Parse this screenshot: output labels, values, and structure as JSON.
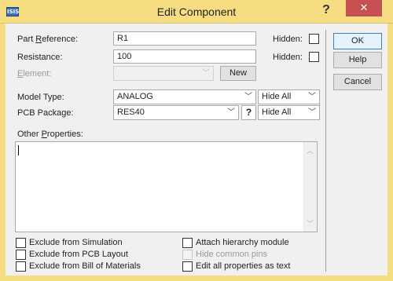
{
  "window": {
    "title": "Edit Component",
    "app_icon_text": "ISIS",
    "help_glyph": "?",
    "close_glyph": "✕"
  },
  "fields": {
    "part_reference": {
      "label_prefix": "Part ",
      "label_underline": "R",
      "label_suffix": "eference:",
      "value": "R1",
      "hidden_label": "Hidden:"
    },
    "resistance": {
      "label": "Resistance:",
      "value": "100",
      "hidden_label": "Hidden:"
    },
    "element": {
      "label_underline": "E",
      "label_suffix": "lement:",
      "value": "",
      "button": "New"
    },
    "model_type": {
      "label": "Model Type:",
      "value": "ANALOG",
      "hide_value": "Hide All"
    },
    "pcb_package": {
      "label": "PCB Package:",
      "value": "RES40",
      "query_button": "?",
      "hide_value": "Hide All"
    },
    "other_properties": {
      "label_prefix": "Other ",
      "label_underline": "P",
      "label_suffix": "roperties:",
      "value": ""
    }
  },
  "buttons": {
    "ok": "OK",
    "help": "Help",
    "cancel": "Cancel"
  },
  "checkboxes": {
    "exclude_simulation": "Exclude from Simulation",
    "exclude_pcb": "Exclude from PCB Layout",
    "exclude_bom": "Exclude from Bill of Materials",
    "attach_hierarchy": "Attach hierarchy module",
    "hide_common_pins": "Hide common pins",
    "edit_all_properties": "Edit all properties as text"
  },
  "colors": {
    "title_bar": "#f7dd82",
    "close_button": "#c75050",
    "default_button_border": "#3c7fb1"
  }
}
